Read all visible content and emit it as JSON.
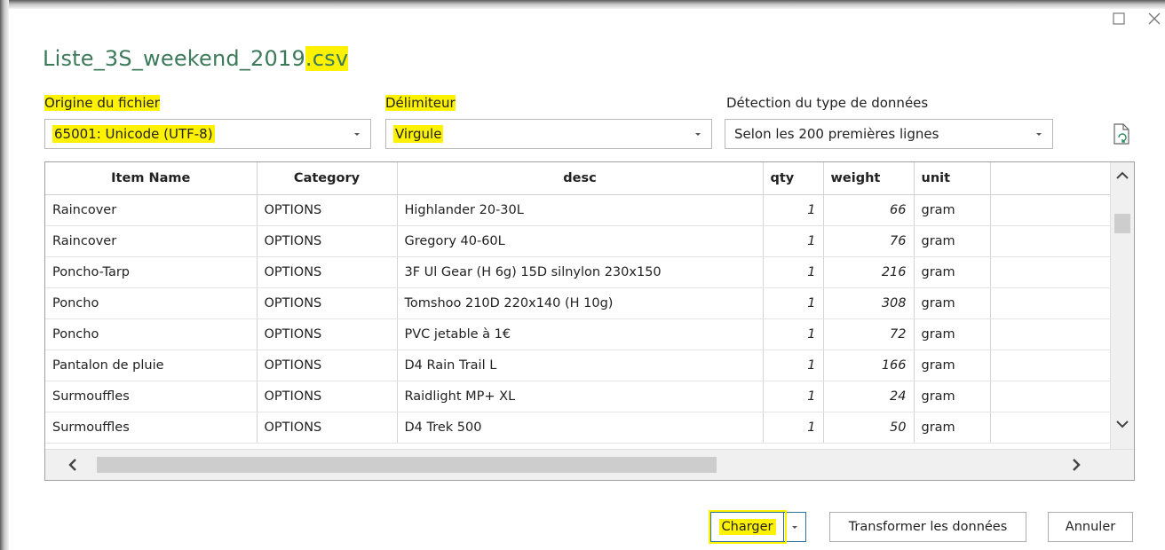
{
  "dialog": {
    "title_main": "Liste_3S_weekend_2019",
    "title_ext": ".csv"
  },
  "origin": {
    "label": "Origine du fichier",
    "value": "65001: Unicode (UTF-8)"
  },
  "delimiter": {
    "label": "Délimiteur",
    "value": "Virgule"
  },
  "detection": {
    "label": "Détection du type de données",
    "value": "Selon les 200 premières lignes"
  },
  "table": {
    "columns": [
      "Item Name",
      "Category",
      "desc",
      "qty",
      "weight",
      "unit"
    ],
    "rows": [
      [
        "Raincover",
        "OPTIONS",
        "Highlander 20-30L",
        "1",
        "66",
        "gram"
      ],
      [
        "Raincover",
        "OPTIONS",
        "Gregory 40-60L",
        "1",
        "76",
        "gram"
      ],
      [
        "Poncho-Tarp",
        "OPTIONS",
        "3F Ul Gear (H 6g) 15D silnylon 230x150",
        "1",
        "216",
        "gram"
      ],
      [
        "Poncho",
        "OPTIONS",
        "Tomshoo 210D 220x140 (H 10g)",
        "1",
        "308",
        "gram"
      ],
      [
        "Poncho",
        "OPTIONS",
        "PVC jetable à 1€",
        "1",
        "72",
        "gram"
      ],
      [
        "Pantalon de pluie",
        "OPTIONS",
        "D4 Rain Trail L",
        "1",
        "166",
        "gram"
      ],
      [
        "Surmouffles",
        "OPTIONS",
        "Raidlight MP+ XL",
        "1",
        "24",
        "gram"
      ],
      [
        "Surmouffles",
        "OPTIONS",
        "D4 Trek 500",
        "1",
        "50",
        "gram"
      ]
    ]
  },
  "buttons": {
    "load": "Charger",
    "transform": "Transformer les données",
    "cancel": "Annuler"
  },
  "icons": {
    "restore": "restore-icon",
    "close": "close-icon",
    "refresh": "refresh-file-icon"
  },
  "colors": {
    "title": "#3c7a5a",
    "highlight": "#fff200",
    "accent_border": "#2e6f9e"
  }
}
